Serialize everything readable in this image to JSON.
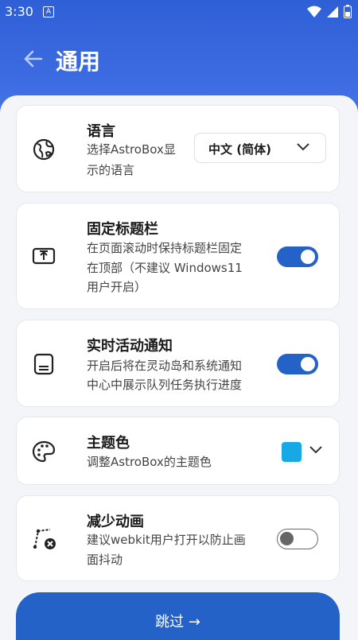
{
  "status": {
    "time": "3:30",
    "notif": "A"
  },
  "header": {
    "title": "通用"
  },
  "language": {
    "title": "语言",
    "desc_line1": "选择AstroBox显",
    "desc_line2": "示的语言",
    "selected": "中文 (简体)"
  },
  "fixed_title": {
    "title": "固定标题栏",
    "desc_line1": "在页面滚动时保持标题栏固定",
    "desc_line2": "在顶部（不建议 Windows11",
    "desc_line3": "用户开启）",
    "enabled": true
  },
  "live_activity": {
    "title": "实时活动通知",
    "desc_line1": "开启后将在灵动岛和系统通知",
    "desc_line2": "中心中展示队列任务执行进度",
    "enabled": true
  },
  "theme": {
    "title": "主题色",
    "desc": "调整AstroBox的主题色",
    "color": "#17a9e6"
  },
  "reduce_motion": {
    "title": "减少动画",
    "desc_line1": "建议webkit用户打开以防止画",
    "desc_line2": "面抖动",
    "enabled": false
  },
  "footer": {
    "skip_label": "跳过 →"
  },
  "colors": {
    "accent": "#2462c8",
    "header": "#3d6ce2"
  }
}
